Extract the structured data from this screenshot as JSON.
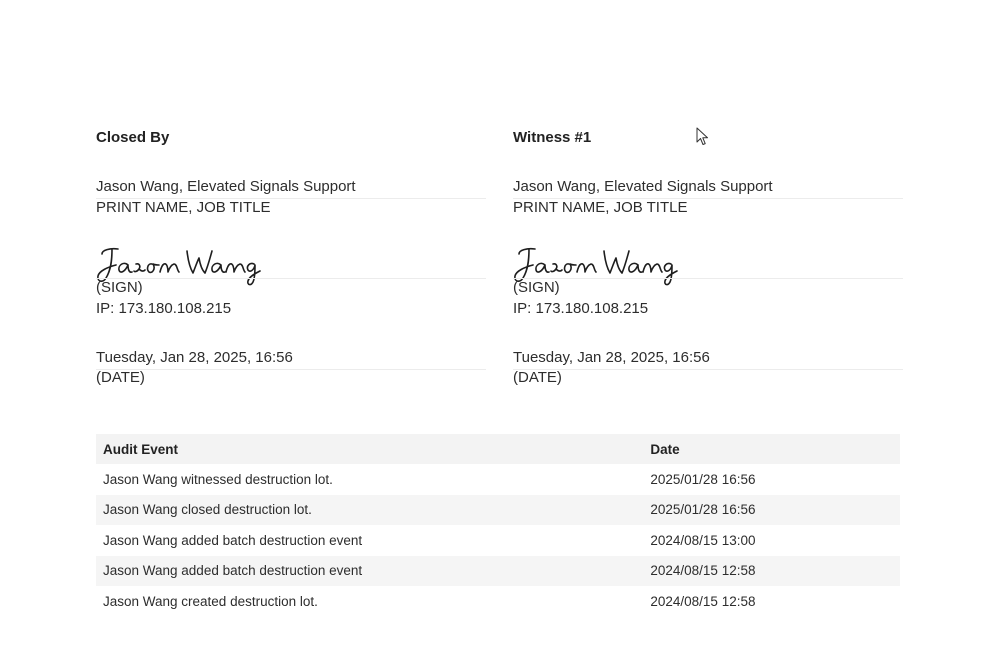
{
  "closed_by": {
    "heading": "Closed By",
    "name_value": "Jason Wang, Elevated Signals Support",
    "name_caption": "PRINT NAME, JOB TITLE",
    "signature_text": "Jason Wang",
    "sign_caption": "(SIGN)",
    "ip": "IP: 173.180.108.215",
    "date_value": "Tuesday, Jan 28, 2025, 16:56",
    "date_caption": "(DATE)"
  },
  "witness": {
    "heading": "Witness #1",
    "name_value": "Jason Wang, Elevated Signals Support",
    "name_caption": "PRINT NAME, JOB TITLE",
    "signature_text": "Jason Wang",
    "sign_caption": "(SIGN)",
    "ip": "IP: 173.180.108.215",
    "date_value": "Tuesday, Jan 28, 2025, 16:56",
    "date_caption": "(DATE)"
  },
  "audit": {
    "headers": {
      "event": "Audit Event",
      "date": "Date"
    },
    "rows": [
      {
        "event": "Jason Wang witnessed destruction lot.",
        "date": "2025/01/28 16:56"
      },
      {
        "event": "Jason Wang closed destruction lot.",
        "date": "2025/01/28 16:56"
      },
      {
        "event": "Jason Wang added batch destruction event",
        "date": "2024/08/15 13:00"
      },
      {
        "event": "Jason Wang added batch destruction event",
        "date": "2024/08/15 12:58"
      },
      {
        "event": "Jason Wang created destruction lot.",
        "date": "2024/08/15 12:58"
      }
    ]
  },
  "cursor": {
    "icon": "mouse-pointer-icon"
  }
}
